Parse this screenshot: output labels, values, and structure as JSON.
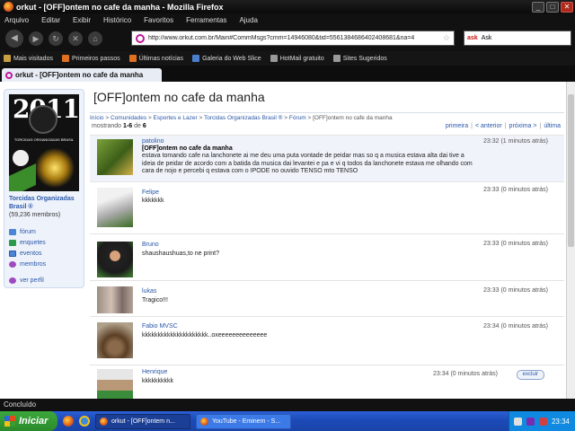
{
  "window": {
    "title": "orkut - [OFF]ontem no cafe da manha - Mozilla Firefox"
  },
  "menu": [
    "Arquivo",
    "Editar",
    "Exibir",
    "Histórico",
    "Favoritos",
    "Ferramentas",
    "Ajuda"
  ],
  "navbar": {
    "url": "http://www.orkut.com.br/Main#CommMsgs?cmm=14946080&tid=5561384686402408681&na=4",
    "search_engine": "Ask"
  },
  "bookmarks": [
    "Mais visitados",
    "Primeiros passos",
    "Últimas notícias",
    "Galeria do Web Slice",
    "HotMail gratuito",
    "Sites Sugeridos"
  ],
  "tab": {
    "label": "orkut - [OFF]ontem no cafe da manha"
  },
  "community": {
    "image_year": "2011",
    "image_banner": "TORCIDAS ORGANIZADAS BRASIL",
    "name": "Torcidas Organizadas Brasil ®",
    "members": "(59,236 membros)",
    "links": [
      {
        "label": "fórum",
        "icon": "forum-icon"
      },
      {
        "label": "enquetes",
        "icon": "polls-icon"
      },
      {
        "label": "eventos",
        "icon": "events-icon"
      },
      {
        "label": "membros",
        "icon": "members-icon"
      }
    ],
    "profile_link": "ver perfil"
  },
  "topic": {
    "title": "[OFF]ontem no cafe da manha",
    "breadcrumb": [
      "Início",
      "Comunidades",
      "Esportes e Lazer",
      "Torcidas Organizadas Brasil ®",
      "Fórum"
    ],
    "breadcrumb_current": "[OFF]ontem no cafe da manha",
    "showing_prefix": "mostrando",
    "showing_range": "1-6",
    "showing_of": "de",
    "showing_total": "6",
    "pager": [
      "primeira",
      "< anterior",
      "próxima >",
      "última"
    ]
  },
  "posts": [
    {
      "author": "patolino",
      "time": "23:32 (1 minutos atrás)",
      "title": "[OFF]ontem no cafe da manha",
      "text": "estava tomando cafe na lanchonete ai me deu uma puta vontade de peidar mas so q a musica estava alta dai tive a ideia de peidar de acordo com a batida da musica dai levantei e pa e vi q todos da lanchonete estava me olhando com cara de nojo e percebi q estava com o IPODE no ouvido TENSO mto TENSO"
    },
    {
      "author": "Felipe",
      "time": "23:33 (0 minutos atrás)",
      "text": "kkkkkkk"
    },
    {
      "author": "Bruno",
      "time": "23:33 (0 minutos atrás)",
      "text": "shaushaushuas,to ne print?"
    },
    {
      "author": "lukas",
      "time": "23:33 (0 minutos atrás)",
      "text": "Tragico!!!"
    },
    {
      "author": "Fabio MVSC",
      "time": "23:34 (0 minutos atrás)",
      "text": "kkkkkkkkkkkkkkkkkkkkk..oxeeeeeeeeeeeeee"
    },
    {
      "author": "Henrique",
      "time": "23:34 (0 minutos atrás)",
      "text": "kkkkkkkkkk",
      "delete_label": "excluir"
    }
  ],
  "statusbar": {
    "text": "Concluído"
  },
  "taskbar": {
    "start": "Iniciar",
    "items": [
      "orkut - [OFF]ontem n...",
      "YouTube - Eminem - S..."
    ],
    "clock": "23:34"
  }
}
